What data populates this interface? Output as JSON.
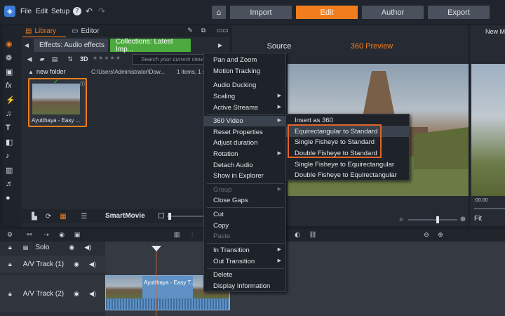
{
  "menu": {
    "file": "File",
    "edit": "Edit",
    "setup": "Setup"
  },
  "top_tabs": [
    "Import",
    "Edit",
    "Author",
    "Export"
  ],
  "library": {
    "library_tab": "Library",
    "editor_tab": "Editor"
  },
  "sub_tabs": [
    "Effects: Audio effects",
    "Collections: Latest Imp..."
  ],
  "toolbar": {
    "view_3d": "3D",
    "search_placeholder": "Search your current view"
  },
  "folder": {
    "name": "new folder",
    "path": "C:\\Users\\Administrator\\Dow...",
    "count": "1 items, 1 s"
  },
  "thumb": {
    "label": "Ayutthaya - Easy ..."
  },
  "lib_bottom": {
    "smartmovie": "SmartMovie"
  },
  "preview": {
    "source": "Source",
    "preview_360": "360 Preview",
    "new_m": "New M",
    "fit": "Fit",
    "timecode": ":00.00"
  },
  "timeline": {
    "solo": "Solo",
    "track1": "A/V Track (1)",
    "track2": "A/V Track (2)",
    "clip_label": "Ayutthaya - Easy T..."
  },
  "context_menu": [
    {
      "label": "Pan and Zoom"
    },
    {
      "label": "Motion Tracking"
    },
    {
      "label": "Audio Ducking"
    },
    {
      "label": "Scaling"
    },
    {
      "label": "Active Streams"
    },
    {
      "label": "360 Video"
    },
    {
      "label": "Reset Properties"
    },
    {
      "label": "Adjust duration"
    },
    {
      "label": "Rotation"
    },
    {
      "label": "Detach Audio"
    },
    {
      "label": "Show in Explorer"
    },
    {
      "label": "Group"
    },
    {
      "label": "Close Gaps"
    },
    {
      "label": "Cut"
    },
    {
      "label": "Copy"
    },
    {
      "label": "Paste"
    },
    {
      "label": "In Transition"
    },
    {
      "label": "Out Transition"
    },
    {
      "label": "Delete"
    },
    {
      "label": "Display Information"
    }
  ],
  "sub_menu": [
    {
      "label": "Insert as 360"
    },
    {
      "label": "Equirectangular to Standard"
    },
    {
      "label": "Single Fisheye to Standard"
    },
    {
      "label": "Double Fisheye to Standard"
    },
    {
      "label": "Single Fisheye to Equirectangular"
    },
    {
      "label": "Double Fisheye to Equirectangular"
    }
  ],
  "colors": {
    "accent": "#f27d1c",
    "highlight": "#e0632a",
    "collections_tab": "#4ba93d",
    "clip": "#5f91c4"
  }
}
